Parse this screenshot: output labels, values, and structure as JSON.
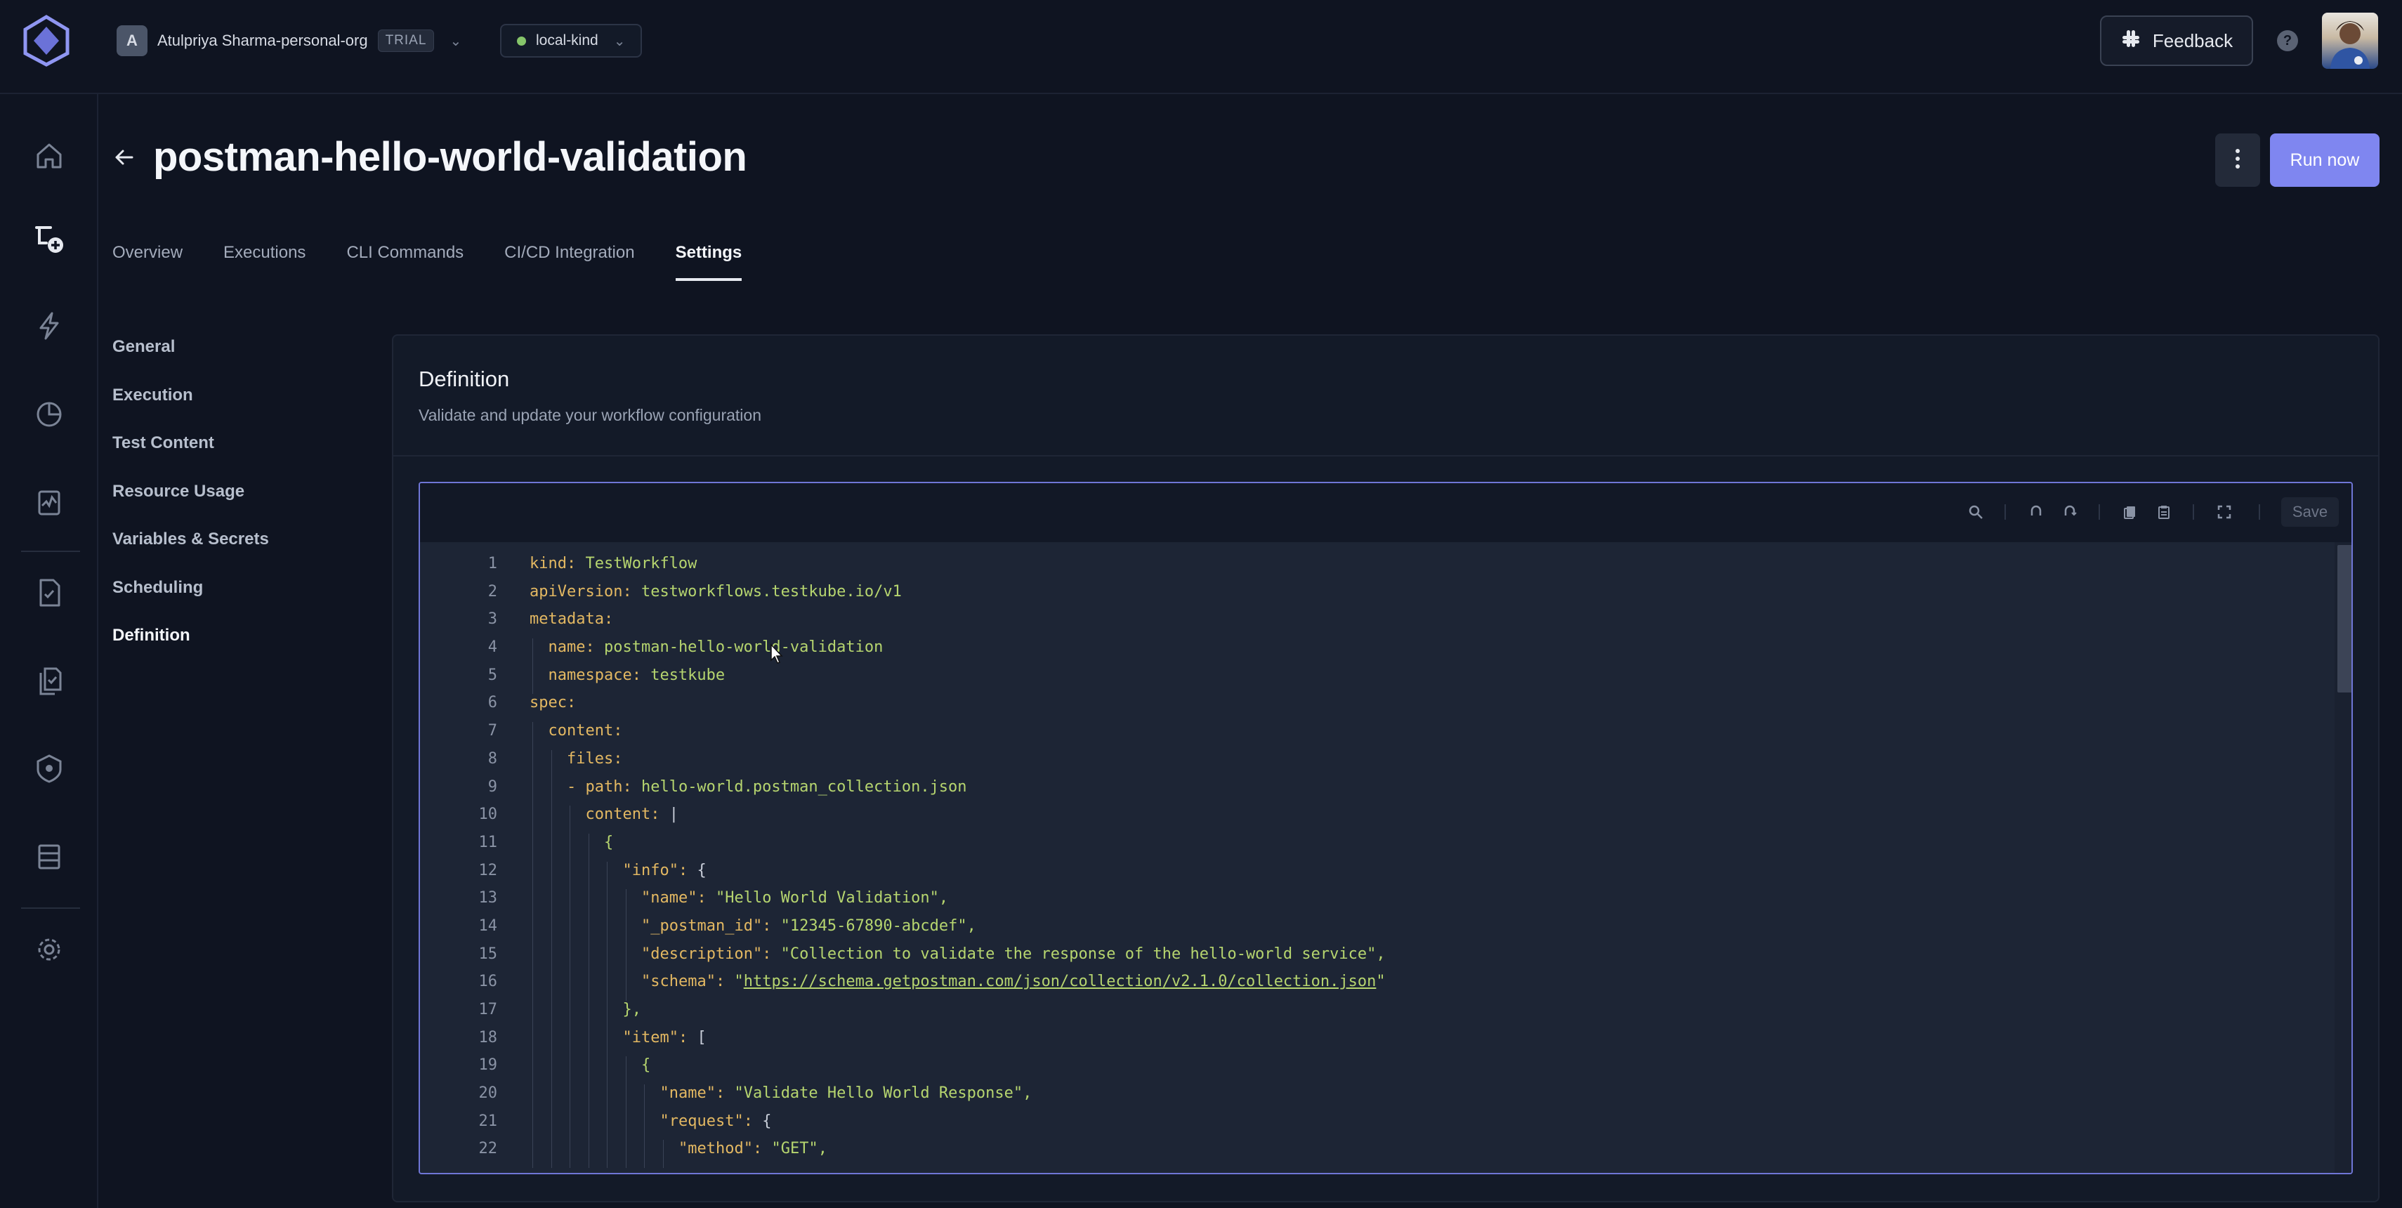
{
  "header": {
    "org_avatar_letter": "A",
    "org_name": "Atulpriya Sharma-personal-org",
    "plan_badge": "TRIAL",
    "environment": "local-kind",
    "feedback_label": "Feedback",
    "help_label": "?"
  },
  "page": {
    "title": "postman-hello-world-validation",
    "run_now_label": "Run now"
  },
  "tabs": [
    {
      "label": "Overview",
      "active": false
    },
    {
      "label": "Executions",
      "active": false
    },
    {
      "label": "CLI Commands",
      "active": false
    },
    {
      "label": "CI/CD Integration",
      "active": false
    },
    {
      "label": "Settings",
      "active": true
    }
  ],
  "settings_menu": [
    {
      "label": "General",
      "active": false
    },
    {
      "label": "Execution",
      "active": false
    },
    {
      "label": "Test Content",
      "active": false
    },
    {
      "label": "Resource Usage",
      "active": false
    },
    {
      "label": "Variables & Secrets",
      "active": false
    },
    {
      "label": "Scheduling",
      "active": false
    },
    {
      "label": "Definition",
      "active": true
    }
  ],
  "panel": {
    "title": "Definition",
    "subtitle": "Validate and update your workflow configuration",
    "save_label": "Save"
  },
  "editor_lines": [
    {
      "n": "1",
      "indent": 0,
      "key": "kind:",
      "val": " TestWorkflow"
    },
    {
      "n": "2",
      "indent": 0,
      "key": "apiVersion:",
      "val": " testworkflows.testkube.io/v1"
    },
    {
      "n": "3",
      "indent": 0,
      "key": "metadata:",
      "val": ""
    },
    {
      "n": "4",
      "indent": 1,
      "key": "name:",
      "val": " postman-hello-world-validation"
    },
    {
      "n": "5",
      "indent": 1,
      "key": "namespace:",
      "val": " testkube"
    },
    {
      "n": "6",
      "indent": 0,
      "key": "spec:",
      "val": ""
    },
    {
      "n": "7",
      "indent": 1,
      "key": "content:",
      "val": ""
    },
    {
      "n": "8",
      "indent": 2,
      "key": "files:",
      "val": ""
    },
    {
      "n": "9",
      "indent": 2,
      "key": "- path:",
      "val": " hello-world.postman_collection.json"
    },
    {
      "n": "10",
      "indent": 3,
      "key": "content:",
      "val": " |"
    },
    {
      "n": "11",
      "indent": 4,
      "key": "",
      "val": "{"
    },
    {
      "n": "12",
      "indent": 5,
      "key": "\"info\":",
      "val": " {"
    },
    {
      "n": "13",
      "indent": 6,
      "key": "\"name\":",
      "val": " \"Hello World Validation\","
    },
    {
      "n": "14",
      "indent": 6,
      "key": "\"_postman_id\":",
      "val": " \"12345-67890-abcdef\","
    },
    {
      "n": "15",
      "indent": 6,
      "key": "\"description\":",
      "val": " \"Collection to validate the response of the hello-world service\","
    },
    {
      "n": "16",
      "indent": 6,
      "key": "\"schema\":",
      "val": " \"",
      "link": "https://schema.getpostman.com/json/collection/v2.1.0/collection.json",
      "tail": "\""
    },
    {
      "n": "17",
      "indent": 5,
      "key": "",
      "val": "},"
    },
    {
      "n": "18",
      "indent": 5,
      "key": "\"item\":",
      "val": " ["
    },
    {
      "n": "19",
      "indent": 6,
      "key": "",
      "val": "{"
    },
    {
      "n": "20",
      "indent": 7,
      "key": "\"name\":",
      "val": " \"Validate Hello World Response\","
    },
    {
      "n": "21",
      "indent": 7,
      "key": "\"request\":",
      "val": " {"
    },
    {
      "n": "22",
      "indent": 8,
      "key": "\"method\":",
      "val": " \"GET\","
    }
  ],
  "icons": {
    "logo": "testkube-logo-icon",
    "sidebar": [
      "home-icon",
      "workflow-add-icon",
      "lightning-icon",
      "pie-chart-icon",
      "insights-icon",
      "test-file-icon",
      "test-suites-icon",
      "shield-icon",
      "list-icon",
      "gear-icon"
    ],
    "toolbar": [
      "search-icon",
      "undo-icon",
      "redo-icon",
      "copy-icon",
      "paste-icon",
      "fullscreen-icon"
    ]
  },
  "colors": {
    "accent": "#7f86f0",
    "yaml_key": "#e3b862",
    "yaml_value": "#b6d56f",
    "env_status": "#86c56a"
  }
}
